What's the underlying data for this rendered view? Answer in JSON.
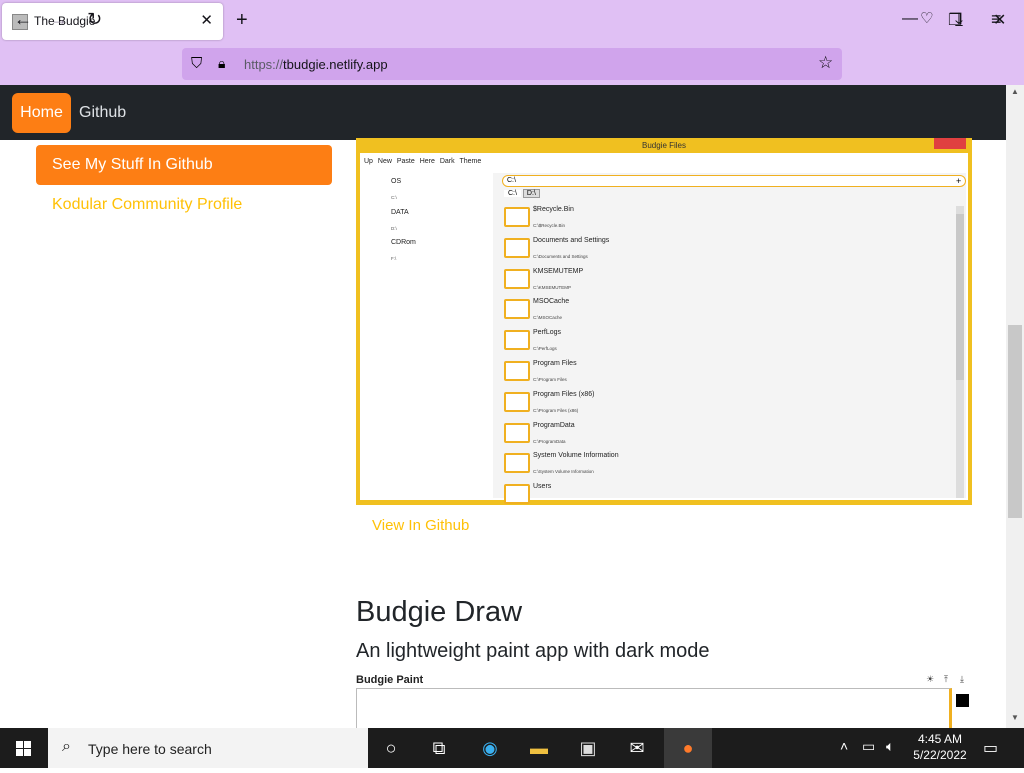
{
  "browser": {
    "tab_title": "The Budgie",
    "new_tab_label": "+",
    "url_scheme": "https://",
    "url_host": "tbudgie.netlify.app"
  },
  "site_nav": {
    "home": "Home",
    "github": "Github"
  },
  "sidebar": {
    "stuff_button": "See My Stuff In Github",
    "kodular_link": "Kodular Community Profile"
  },
  "budgie_files": {
    "window_title": "Budgie Files",
    "menu": [
      "Up",
      "New",
      "Paste Here",
      "Dark Theme"
    ],
    "drives": [
      {
        "name": "OS",
        "path": "C:\\"
      },
      {
        "name": "DATA",
        "path": "D:\\"
      },
      {
        "name": "CDRom",
        "path": "F:\\"
      }
    ],
    "address": "C:\\",
    "tabs": [
      "C:\\",
      "D:\\"
    ],
    "folders": [
      {
        "name": "$Recycle.Bin",
        "path": "C:\\$Recycle.Bin"
      },
      {
        "name": "Documents and Settings",
        "path": "C:\\Documents and Settings"
      },
      {
        "name": "KMSEMUTEMP",
        "path": "C:\\KMSEMUTEMP"
      },
      {
        "name": "MSOCache",
        "path": "C:\\MSOCache"
      },
      {
        "name": "PerfLogs",
        "path": "C:\\PerfLogs"
      },
      {
        "name": "Program Files",
        "path": "C:\\Program Files"
      },
      {
        "name": "Program Files (x86)",
        "path": "C:\\Program Files (x86)"
      },
      {
        "name": "ProgramData",
        "path": "C:\\ProgramData"
      },
      {
        "name": "System Volume Information",
        "path": "C:\\System Volume Information"
      },
      {
        "name": "Users",
        "path": ""
      }
    ]
  },
  "view_github": "View In Github",
  "draw_section": {
    "title": "Budgie Draw",
    "subtitle": "An lightweight paint app with dark mode",
    "paint_title": "Budgie Paint"
  },
  "taskbar": {
    "search_placeholder": "Type here to search",
    "time": "4:45 AM",
    "date": "5/22/2022"
  },
  "colors": {
    "accent_orange": "#fd7e14",
    "link_yellow": "#ffc107",
    "navbar_dark": "#212529",
    "browser_purple": "#e0c0f4"
  }
}
